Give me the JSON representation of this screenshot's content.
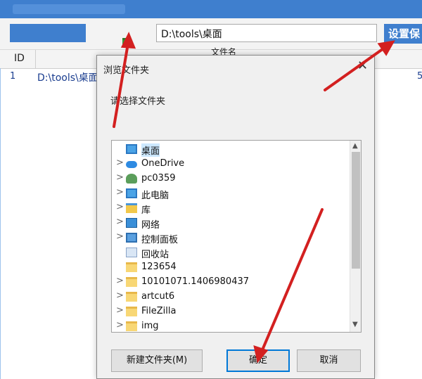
{
  "toolbar": {
    "path_value": "D:\\tools\\桌面",
    "set_save_label": "设置保"
  },
  "grid": {
    "headers": [
      "ID",
      "文件名"
    ],
    "rows": [
      {
        "id": "1",
        "path": "D:\\tools\\桌面",
        "extra": "5"
      }
    ]
  },
  "dialog": {
    "title": "浏览文件夹",
    "close_glyph": "✕",
    "prompt": "请选择文件夹",
    "tree": [
      {
        "label": "桌面",
        "icon": "desktop-icon",
        "chevron": ""
      },
      {
        "label": "OneDrive",
        "icon": "onedrive-icon",
        "chevron": ">"
      },
      {
        "label": "pc0359",
        "icon": "user-icon",
        "chevron": ">"
      },
      {
        "label": "此电脑",
        "icon": "computer-icon",
        "chevron": ">"
      },
      {
        "label": "库",
        "icon": "library-icon",
        "chevron": ">"
      },
      {
        "label": "网络",
        "icon": "network-icon",
        "chevron": ">"
      },
      {
        "label": "控制面板",
        "icon": "control-panel-icon",
        "chevron": ">"
      },
      {
        "label": "回收站",
        "icon": "recycle-bin-icon",
        "chevron": ""
      },
      {
        "label": "123654",
        "icon": "folder-icon",
        "chevron": ""
      },
      {
        "label": "10101071.1406980437",
        "icon": "folder-icon",
        "chevron": ">"
      },
      {
        "label": "artcut6",
        "icon": "folder-icon",
        "chevron": ">"
      },
      {
        "label": "FileZilla",
        "icon": "folder-icon",
        "chevron": ">"
      },
      {
        "label": "img",
        "icon": "folder-icon",
        "chevron": ">"
      }
    ],
    "buttons": {
      "new_folder": "新建文件夹(M)",
      "ok": "确定",
      "cancel": "取消"
    }
  },
  "colors": {
    "accent": "#3f7fce",
    "annotation": "#d32020"
  }
}
